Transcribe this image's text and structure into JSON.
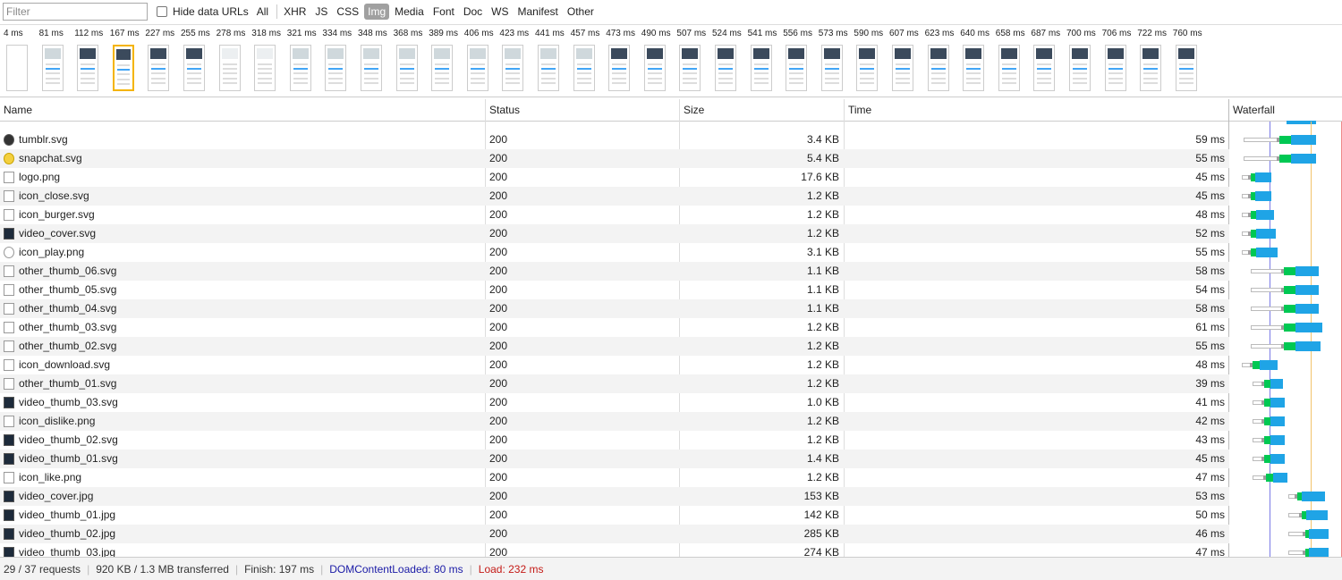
{
  "toolbar": {
    "filter_placeholder": "Filter",
    "hide_data_urls_label": "Hide data URLs",
    "types": [
      "All",
      "XHR",
      "JS",
      "CSS",
      "Img",
      "Media",
      "Font",
      "Doc",
      "WS",
      "Manifest",
      "Other"
    ],
    "active_type": "Img"
  },
  "filmstrip": {
    "frames": [
      {
        "time": "4 ms",
        "style": "blank"
      },
      {
        "time": "81 ms",
        "style": "light"
      },
      {
        "time": "112 ms",
        "style": "dark"
      },
      {
        "time": "167 ms",
        "style": "dark",
        "selected": true
      },
      {
        "time": "227 ms",
        "style": "dark"
      },
      {
        "time": "255 ms",
        "style": "dark"
      },
      {
        "time": "278 ms",
        "style": "white"
      },
      {
        "time": "318 ms",
        "style": "white"
      },
      {
        "time": "321 ms",
        "style": "light"
      },
      {
        "time": "334 ms",
        "style": "light"
      },
      {
        "time": "348 ms",
        "style": "light"
      },
      {
        "time": "368 ms",
        "style": "light"
      },
      {
        "time": "389 ms",
        "style": "light"
      },
      {
        "time": "406 ms",
        "style": "light"
      },
      {
        "time": "423 ms",
        "style": "light"
      },
      {
        "time": "441 ms",
        "style": "light"
      },
      {
        "time": "457 ms",
        "style": "light"
      },
      {
        "time": "473 ms",
        "style": "dark"
      },
      {
        "time": "490 ms",
        "style": "dark"
      },
      {
        "time": "507 ms",
        "style": "dark"
      },
      {
        "time": "524 ms",
        "style": "dark"
      },
      {
        "time": "541 ms",
        "style": "dark"
      },
      {
        "time": "556 ms",
        "style": "dark"
      },
      {
        "time": "573 ms",
        "style": "dark"
      },
      {
        "time": "590 ms",
        "style": "dark"
      },
      {
        "time": "607 ms",
        "style": "dark"
      },
      {
        "time": "623 ms",
        "style": "dark"
      },
      {
        "time": "640 ms",
        "style": "dark"
      },
      {
        "time": "658 ms",
        "style": "dark"
      },
      {
        "time": "687 ms",
        "style": "dark"
      },
      {
        "time": "700 ms",
        "style": "dark"
      },
      {
        "time": "706 ms",
        "style": "dark"
      },
      {
        "time": "722 ms",
        "style": "dark"
      },
      {
        "time": "760 ms",
        "style": "dark"
      }
    ]
  },
  "columns": {
    "name": "Name",
    "status": "Status",
    "size": "Size",
    "time": "Time",
    "waterfall": "Waterfall"
  },
  "rows": [
    {
      "name": "tumblr.svg",
      "status": "200",
      "size": "3.4 KB",
      "time": "59 ms",
      "icon": "circle-dark-icon"
    },
    {
      "name": "snapchat.svg",
      "status": "200",
      "size": "5.4 KB",
      "time": "55 ms",
      "icon": "circle-yellow-icon"
    },
    {
      "name": "logo.png",
      "status": "200",
      "size": "17.6 KB",
      "time": "45 ms",
      "icon": "image-icon"
    },
    {
      "name": "icon_close.svg",
      "status": "200",
      "size": "1.2 KB",
      "time": "45 ms",
      "icon": "file-icon"
    },
    {
      "name": "icon_burger.svg",
      "status": "200",
      "size": "1.2 KB",
      "time": "48 ms",
      "icon": "file-icon"
    },
    {
      "name": "video_cover.svg",
      "status": "200",
      "size": "1.2 KB",
      "time": "52 ms",
      "icon": "image-dark-icon"
    },
    {
      "name": "icon_play.png",
      "status": "200",
      "size": "3.1 KB",
      "time": "55 ms",
      "icon": "circle-light-icon"
    },
    {
      "name": "other_thumb_06.svg",
      "status": "200",
      "size": "1.1 KB",
      "time": "58 ms",
      "icon": "image-icon"
    },
    {
      "name": "other_thumb_05.svg",
      "status": "200",
      "size": "1.1 KB",
      "time": "54 ms",
      "icon": "image-icon"
    },
    {
      "name": "other_thumb_04.svg",
      "status": "200",
      "size": "1.1 KB",
      "time": "58 ms",
      "icon": "image-icon"
    },
    {
      "name": "other_thumb_03.svg",
      "status": "200",
      "size": "1.2 KB",
      "time": "61 ms",
      "icon": "image-icon"
    },
    {
      "name": "other_thumb_02.svg",
      "status": "200",
      "size": "1.2 KB",
      "time": "55 ms",
      "icon": "image-icon"
    },
    {
      "name": "icon_download.svg",
      "status": "200",
      "size": "1.2 KB",
      "time": "48 ms",
      "icon": "file-icon"
    },
    {
      "name": "other_thumb_01.svg",
      "status": "200",
      "size": "1.2 KB",
      "time": "39 ms",
      "icon": "image-icon"
    },
    {
      "name": "video_thumb_03.svg",
      "status": "200",
      "size": "1.0 KB",
      "time": "41 ms",
      "icon": "image-dark-icon"
    },
    {
      "name": "icon_dislike.png",
      "status": "200",
      "size": "1.2 KB",
      "time": "42 ms",
      "icon": "image-icon"
    },
    {
      "name": "video_thumb_02.svg",
      "status": "200",
      "size": "1.2 KB",
      "time": "43 ms",
      "icon": "image-dark-icon"
    },
    {
      "name": "video_thumb_01.svg",
      "status": "200",
      "size": "1.4 KB",
      "time": "45 ms",
      "icon": "image-dark-icon"
    },
    {
      "name": "icon_like.png",
      "status": "200",
      "size": "1.2 KB",
      "time": "47 ms",
      "icon": "image-icon"
    },
    {
      "name": "video_cover.jpg",
      "status": "200",
      "size": "153 KB",
      "time": "53 ms",
      "icon": "image-dark-icon"
    },
    {
      "name": "video_thumb_01.jpg",
      "status": "200",
      "size": "142 KB",
      "time": "50 ms",
      "icon": "image-dark-icon"
    },
    {
      "name": "video_thumb_02.jpg",
      "status": "200",
      "size": "285 KB",
      "time": "46 ms",
      "icon": "image-dark-icon"
    },
    {
      "name": "video_thumb_03.jpg",
      "status": "200",
      "size": "274 KB",
      "time": "47 ms",
      "icon": "image-dark-icon"
    }
  ],
  "status_bar": {
    "requests": "29 / 37 requests",
    "transferred": "920 KB / 1.3 MB transferred",
    "finish": "Finish: 197 ms",
    "dom_content_loaded": "DOMContentLoaded: 80 ms",
    "load": "Load: 232 ms"
  },
  "colors": {
    "dcl_line": "#1a1aa6",
    "load_line": "#c41a16",
    "bar_receiving": "#1fa4e6",
    "bar_waiting": "#00c853",
    "active_filter": "#a0a0a0"
  }
}
